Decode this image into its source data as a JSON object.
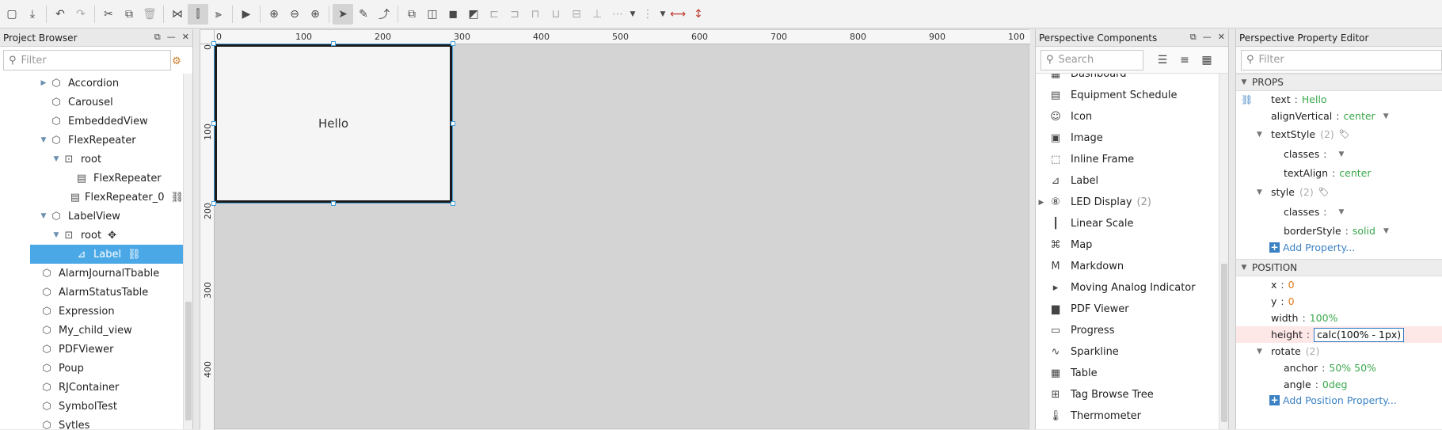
{
  "toolbar": {
    "icons": [
      "save-icon",
      "import-icon",
      "undo-icon",
      "redo-icon",
      "cut-icon",
      "copy-icon",
      "delete-icon",
      "snap-icon",
      "guides-icon",
      "grid-icon",
      "preview-play-icon",
      "zoom-fit-icon",
      "zoom-out-icon",
      "zoom-in-icon",
      "select-tool-icon",
      "path-tool-icon",
      "reshape-tool-icon",
      "group-icon",
      "ungroup-icon",
      "bring-front-icon",
      "send-back-icon",
      "align-left-icon",
      "align-center-icon",
      "align-right-icon",
      "align-top-icon",
      "align-middle-icon",
      "align-bottom-icon",
      "distribute-icon",
      "equal-width-icon",
      "equal-height-icon"
    ]
  },
  "project_browser": {
    "title": "Project Browser",
    "filter_placeholder": "Filter",
    "items": [
      {
        "label": "Accordion",
        "indent": 1,
        "arrow": "right",
        "icon": "view-icon",
        "link": false,
        "selected": false
      },
      {
        "label": "Carousel",
        "indent": 1,
        "arrow": "",
        "icon": "view-icon",
        "link": false,
        "selected": false
      },
      {
        "label": "EmbeddedView",
        "indent": 1,
        "arrow": "",
        "icon": "view-icon",
        "link": false,
        "selected": false
      },
      {
        "label": "FlexRepeater",
        "indent": 1,
        "arrow": "down",
        "icon": "view-icon",
        "link": false,
        "selected": false
      },
      {
        "label": "root",
        "indent": 2,
        "arrow": "down",
        "icon": "container-icon",
        "link": false,
        "selected": false
      },
      {
        "label": "FlexRepeater",
        "indent": 3,
        "arrow": "",
        "icon": "component-icon",
        "link": false,
        "selected": false
      },
      {
        "label": "FlexRepeater_0",
        "indent": 3,
        "arrow": "",
        "icon": "component-icon",
        "link": true,
        "selected": false
      },
      {
        "label": "LabelView",
        "indent": 1,
        "arrow": "down",
        "icon": "view-icon",
        "link": false,
        "selected": false
      },
      {
        "label": "root",
        "indent": 2,
        "arrow": "down",
        "icon": "container-icon",
        "link": false,
        "selected": false,
        "extra": "✥"
      },
      {
        "label": "Label",
        "indent": 3,
        "arrow": "",
        "icon": "label-icon",
        "link": true,
        "selected": true
      },
      {
        "label": "AlarmJournalTbable",
        "indent": 0,
        "arrow": "",
        "icon": "view-icon",
        "link": false,
        "selected": false
      },
      {
        "label": "AlarmStatusTable",
        "indent": 0,
        "arrow": "",
        "icon": "view-icon",
        "link": false,
        "selected": false
      },
      {
        "label": "Expression",
        "indent": 0,
        "arrow": "",
        "icon": "view-icon",
        "link": false,
        "selected": false
      },
      {
        "label": "My_child_view",
        "indent": 0,
        "arrow": "",
        "icon": "view-icon",
        "link": false,
        "selected": false
      },
      {
        "label": "PDFViewer",
        "indent": 0,
        "arrow": "",
        "icon": "view-icon",
        "link": false,
        "selected": false
      },
      {
        "label": "Poup",
        "indent": 0,
        "arrow": "",
        "icon": "view-icon",
        "link": false,
        "selected": false
      },
      {
        "label": "RJContainer",
        "indent": 0,
        "arrow": "",
        "icon": "view-icon",
        "link": false,
        "selected": false
      },
      {
        "label": "SymbolTest",
        "indent": 0,
        "arrow": "",
        "icon": "view-icon",
        "link": false,
        "selected": false
      },
      {
        "label": "Sytles",
        "indent": 0,
        "arrow": "",
        "icon": "view-icon",
        "link": false,
        "selected": false
      }
    ]
  },
  "canvas": {
    "ruler_top": [
      "0",
      "100",
      "200",
      "300",
      "400",
      "500",
      "600",
      "700",
      "800",
      "900",
      "100"
    ],
    "ruler_left": [
      "0",
      "100",
      "200",
      "300",
      "400"
    ],
    "label_text": "Hello"
  },
  "components": {
    "title": "Perspective Components",
    "search_placeholder": "Search",
    "items": [
      {
        "label": "Dashboard",
        "icon": "dashboard-icon",
        "partial": true
      },
      {
        "label": "Equipment Schedule",
        "icon": "schedule-icon"
      },
      {
        "label": "Icon",
        "icon": "smiley-icon"
      },
      {
        "label": "Image",
        "icon": "image-icon"
      },
      {
        "label": "Inline Frame",
        "icon": "frame-icon"
      },
      {
        "label": "Label",
        "icon": "label-icon"
      },
      {
        "label": "LED Display",
        "icon": "led-icon",
        "count": "(2)",
        "expandable": true
      },
      {
        "label": "Linear Scale",
        "icon": "scale-icon"
      },
      {
        "label": "Map",
        "icon": "map-icon"
      },
      {
        "label": "Markdown",
        "icon": "markdown-icon"
      },
      {
        "label": "Moving Analog Indicator",
        "icon": "analog-icon"
      },
      {
        "label": "PDF Viewer",
        "icon": "pdf-icon"
      },
      {
        "label": "Progress",
        "icon": "progress-icon"
      },
      {
        "label": "Sparkline",
        "icon": "sparkline-icon"
      },
      {
        "label": "Table",
        "icon": "table-icon"
      },
      {
        "label": "Tag Browse Tree",
        "icon": "tree-icon"
      },
      {
        "label": "Thermometer",
        "icon": "thermometer-icon"
      }
    ]
  },
  "property_editor": {
    "title": "Perspective Property Editor",
    "filter_placeholder": "Filter",
    "props_section": "PROPS",
    "position_section": "POSITION",
    "props": {
      "text": {
        "key": "text",
        "value": "Hello"
      },
      "alignVertical": {
        "key": "alignVertical",
        "value": "center"
      },
      "textStyle": {
        "key": "textStyle",
        "count": "(2)"
      },
      "textStyle_classes": {
        "key": "classes",
        "value": ""
      },
      "textAlign": {
        "key": "textAlign",
        "value": "center"
      },
      "style": {
        "key": "style",
        "count": "(2)"
      },
      "style_classes": {
        "key": "classes",
        "value": ""
      },
      "borderStyle": {
        "key": "borderStyle",
        "value": "solid"
      },
      "add_property": "Add Property..."
    },
    "position": {
      "x": {
        "key": "x",
        "value": "0"
      },
      "y": {
        "key": "y",
        "value": "0"
      },
      "width": {
        "key": "width",
        "value": "100%"
      },
      "height": {
        "key": "height",
        "value": "calc(100% - 1px)"
      },
      "rotate": {
        "key": "rotate",
        "count": "(2)"
      },
      "anchor": {
        "key": "anchor",
        "value": "50% 50%"
      },
      "angle": {
        "key": "angle",
        "value": "0deg"
      },
      "add_position_property": "Add Position Property..."
    }
  },
  "colors": {
    "selection": "#4aa8e6",
    "value_green": "#3aa84c",
    "value_orange": "#e07b1a",
    "link_blue": "#3b82c4"
  }
}
